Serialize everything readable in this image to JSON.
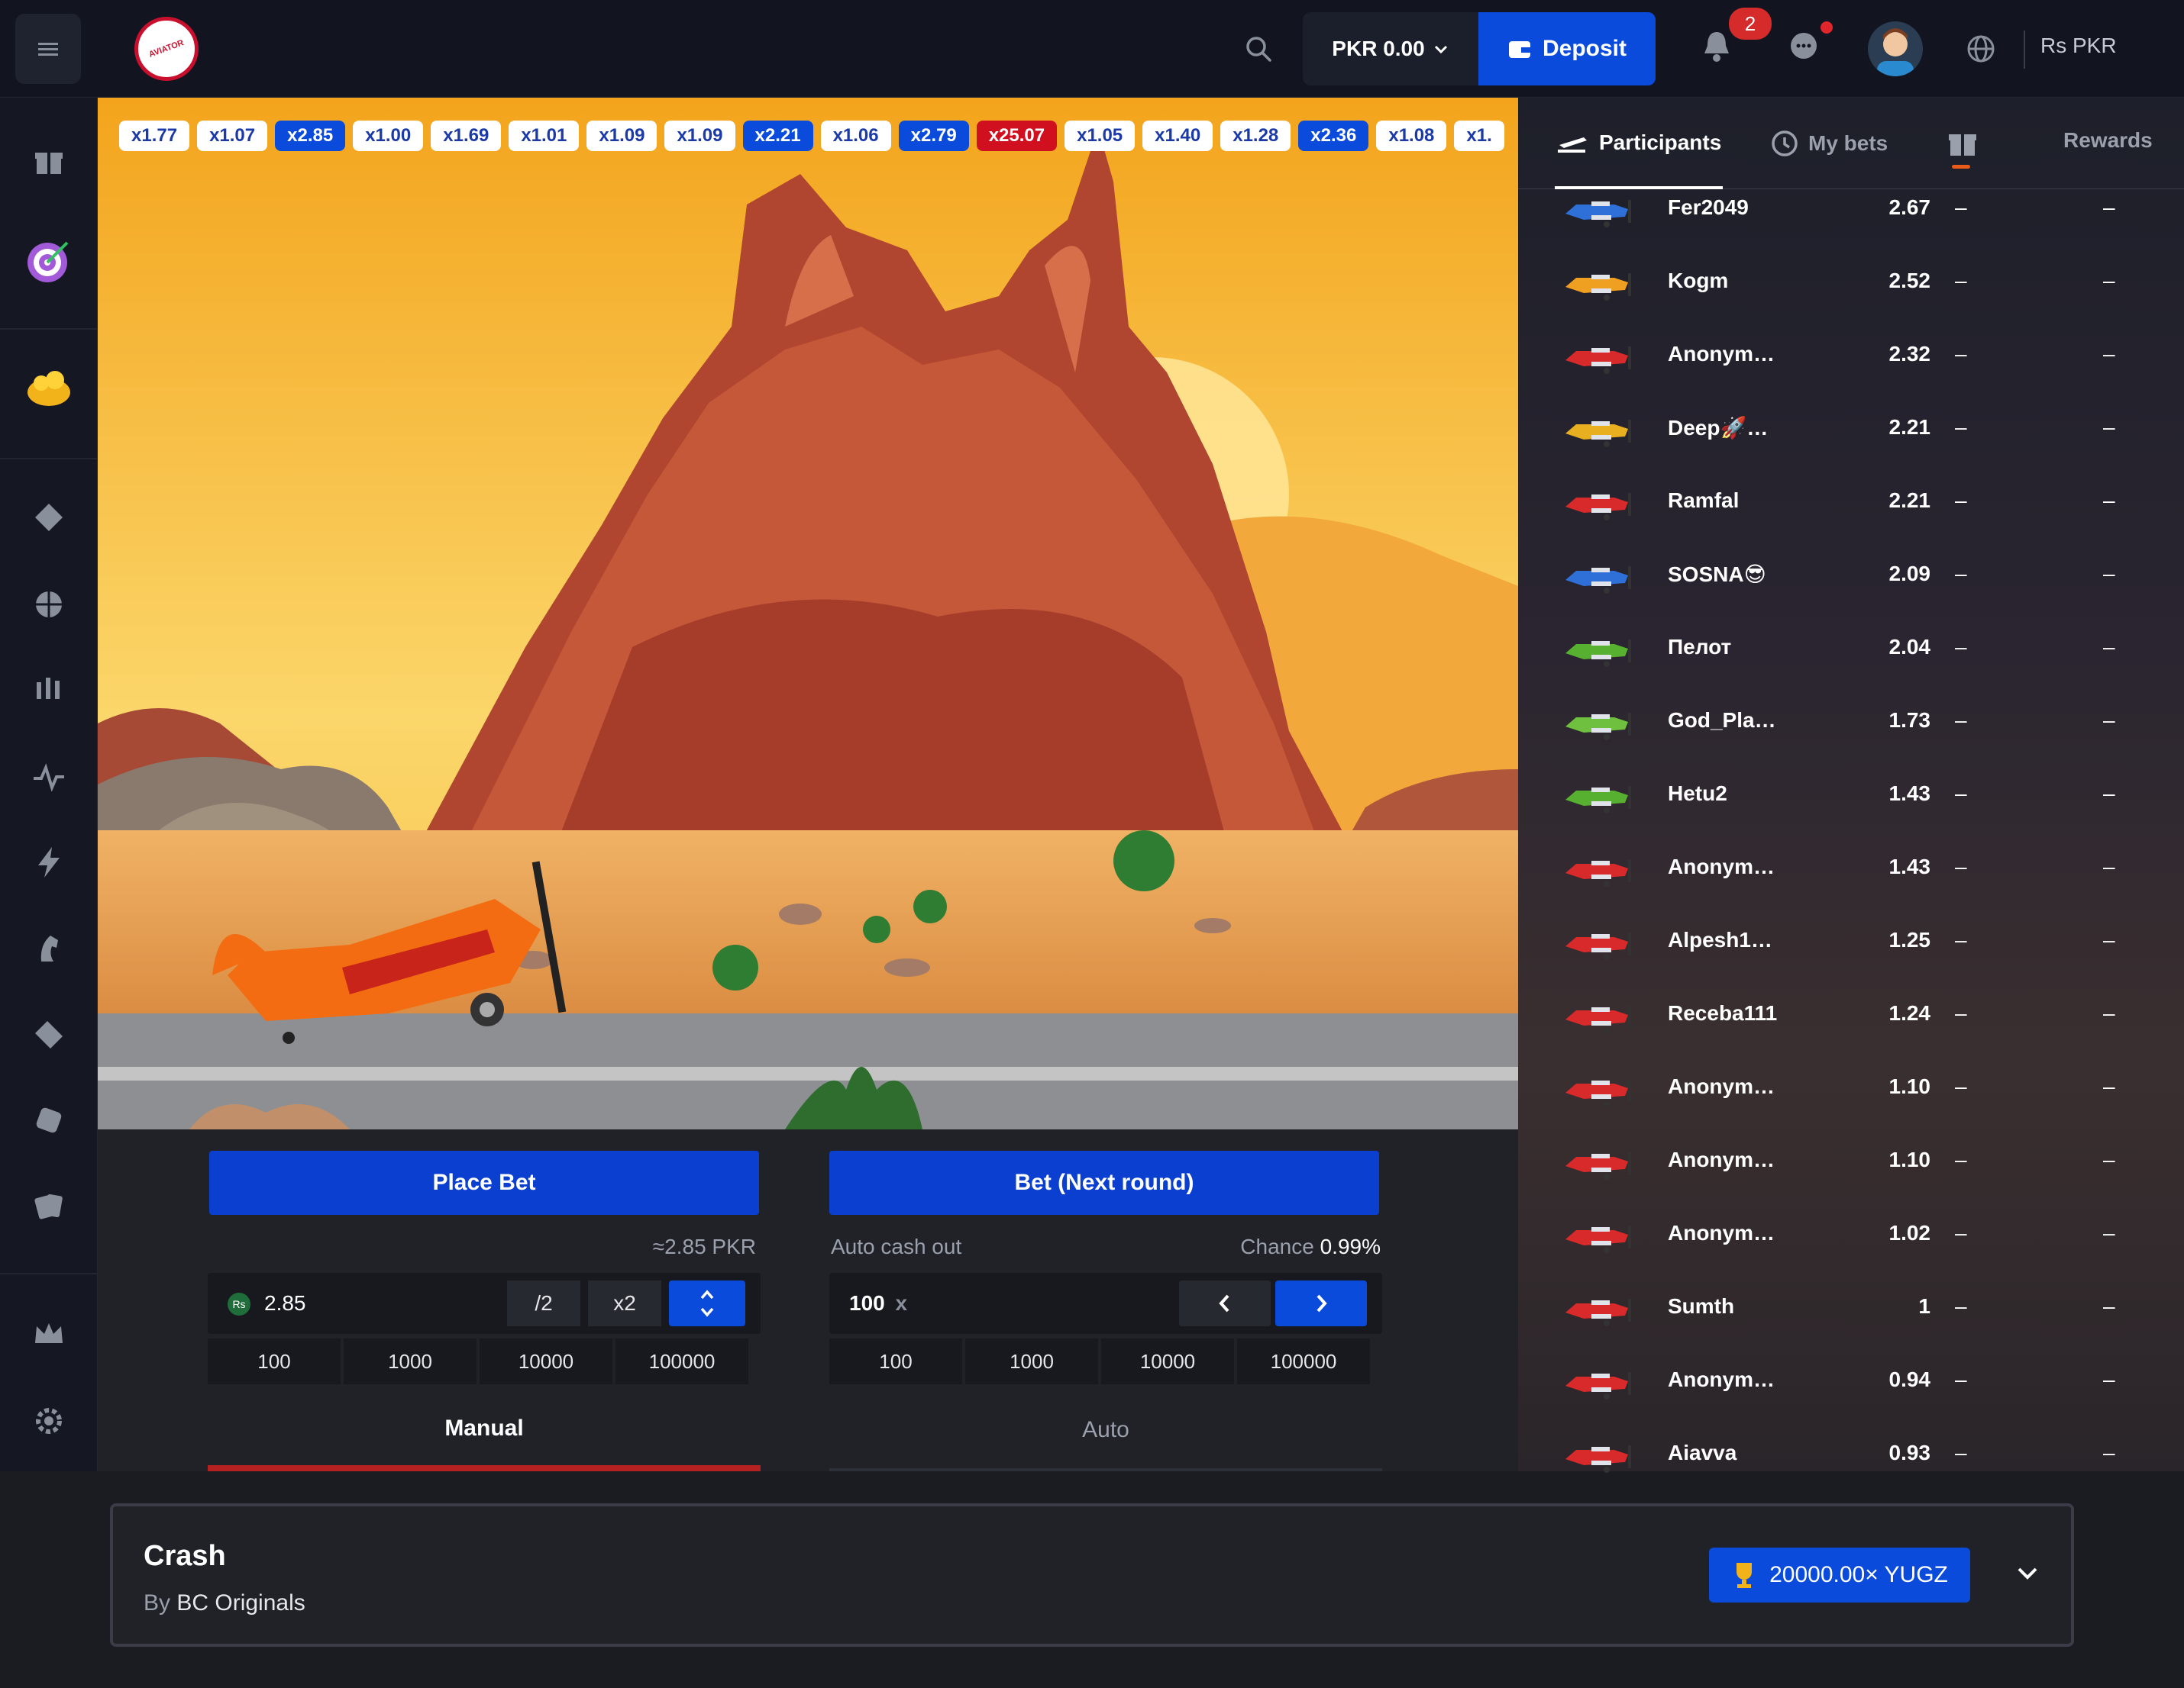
{
  "header": {
    "balance": "PKR 0.00",
    "deposit_label": "Deposit",
    "notif_count": "2",
    "currency_label": "Rs PKR"
  },
  "multipliers": [
    {
      "v": "x1.77",
      "c": "white"
    },
    {
      "v": "x1.07",
      "c": "white"
    },
    {
      "v": "x2.85",
      "c": "blue"
    },
    {
      "v": "x1.00",
      "c": "white"
    },
    {
      "v": "x1.69",
      "c": "white"
    },
    {
      "v": "x1.01",
      "c": "white"
    },
    {
      "v": "x1.09",
      "c": "white"
    },
    {
      "v": "x1.09",
      "c": "white"
    },
    {
      "v": "x2.21",
      "c": "blue"
    },
    {
      "v": "x1.06",
      "c": "white"
    },
    {
      "v": "x2.79",
      "c": "blue"
    },
    {
      "v": "x25.07",
      "c": "red"
    },
    {
      "v": "x1.05",
      "c": "white"
    },
    {
      "v": "x1.40",
      "c": "white"
    },
    {
      "v": "x1.28",
      "c": "white"
    },
    {
      "v": "x2.36",
      "c": "blue"
    },
    {
      "v": "x1.08",
      "c": "white"
    },
    {
      "v": "x1.",
      "c": "white"
    }
  ],
  "bet": {
    "place_label": "Place Bet",
    "approx": "≈2.85 PKR",
    "currency_tag": "Rs",
    "amount": "2.85",
    "half_label": "/2",
    "double_label": "x2",
    "quick": [
      "100",
      "1000",
      "10000",
      "100000"
    ]
  },
  "next": {
    "label": "Bet (Next round)",
    "auto_label": "Auto cash out",
    "chance_label": "Chance",
    "chance_value": "0.99%",
    "cashout_value": "100",
    "cashout_suffix": "x",
    "quick": [
      "100",
      "1000",
      "10000",
      "100000"
    ]
  },
  "mode_tabs": {
    "manual": "Manual",
    "auto": "Auto"
  },
  "right_tabs": {
    "participants": "Participants",
    "mybets": "My bets",
    "rewards": "Rewards"
  },
  "participants": [
    {
      "name": "Fer2049",
      "mult": "2.67",
      "a": "–",
      "b": "–",
      "color": "#2f6fd8"
    },
    {
      "name": "Kogm",
      "mult": "2.52",
      "a": "–",
      "b": "–",
      "color": "#f0a020"
    },
    {
      "name": "Anonym…",
      "mult": "2.32",
      "a": "–",
      "b": "–",
      "color": "#d82a2a"
    },
    {
      "name": "Deep🚀…",
      "mult": "2.21",
      "a": "–",
      "b": "–",
      "color": "#e8b020"
    },
    {
      "name": "Ramfal",
      "mult": "2.21",
      "a": "–",
      "b": "–",
      "color": "#d82a2a"
    },
    {
      "name": "SOSNA😎",
      "mult": "2.09",
      "a": "–",
      "b": "–",
      "color": "#2f6fd8"
    },
    {
      "name": "Пелот",
      "mult": "2.04",
      "a": "–",
      "b": "–",
      "color": "#58b030"
    },
    {
      "name": "God_Pla…",
      "mult": "1.73",
      "a": "–",
      "b": "–",
      "color": "#70c040"
    },
    {
      "name": "Hetu2",
      "mult": "1.43",
      "a": "–",
      "b": "–",
      "color": "#58b030"
    },
    {
      "name": "Anonym…",
      "mult": "1.43",
      "a": "–",
      "b": "–",
      "color": "#d82a2a"
    },
    {
      "name": "Alpesh1…",
      "mult": "1.25",
      "a": "–",
      "b": "–",
      "color": "#d82a2a"
    },
    {
      "name": "Receba111",
      "mult": "1.24",
      "a": "–",
      "b": "–",
      "color": "#d82a2a"
    },
    {
      "name": "Anonym…",
      "mult": "1.10",
      "a": "–",
      "b": "–",
      "color": "#d82a2a"
    },
    {
      "name": "Anonym…",
      "mult": "1.10",
      "a": "–",
      "b": "–",
      "color": "#d82a2a"
    },
    {
      "name": "Anonym…",
      "mult": "1.02",
      "a": "–",
      "b": "–",
      "color": "#d82a2a"
    },
    {
      "name": "Sumth",
      "mult": "1",
      "a": "–",
      "b": "–",
      "color": "#d82a2a"
    },
    {
      "name": "Anonym…",
      "mult": "0.94",
      "a": "–",
      "b": "–",
      "color": "#d82a2a"
    },
    {
      "name": "Aiavva",
      "mult": "0.93",
      "a": "–",
      "b": "–",
      "color": "#d82a2a"
    }
  ],
  "footer": {
    "title": "Crash",
    "by_label": "By",
    "by_value": "BC Originals",
    "badge_text": "20000.00×  YUGZ"
  },
  "logo_text": "AVIATOR",
  "colors": {
    "accent": "#0a4bdc",
    "danger": "#d0101e",
    "bg": "#121520"
  }
}
